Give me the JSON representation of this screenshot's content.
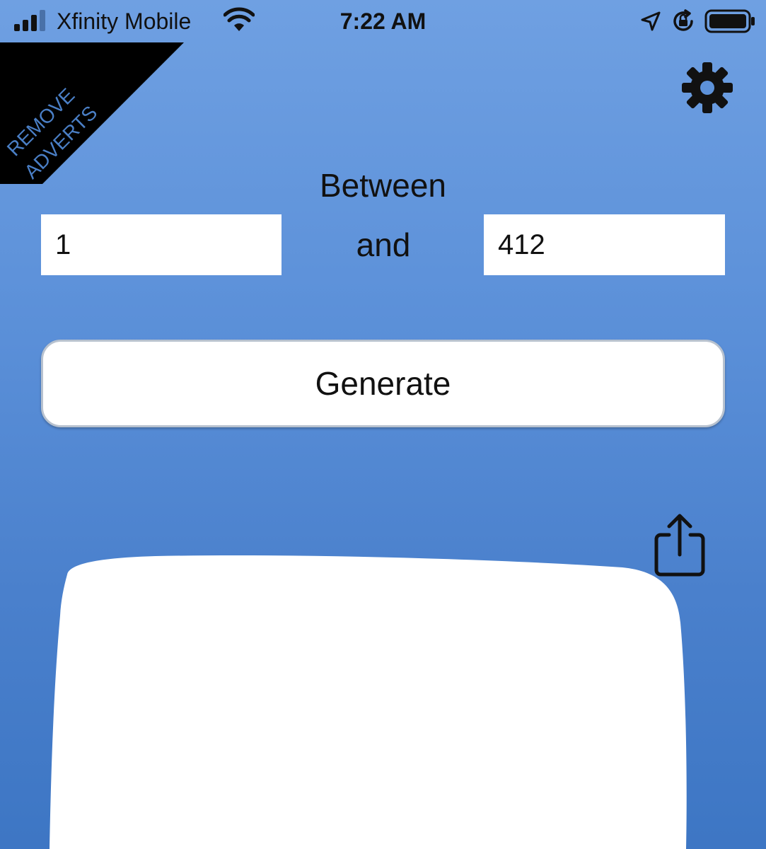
{
  "status_bar": {
    "carrier": "Xfinity Mobile",
    "time": "7:22 AM",
    "icons": [
      "signal-bars-icon",
      "wifi-icon",
      "location-arrow-icon",
      "orientation-lock-icon",
      "battery-icon"
    ]
  },
  "corner_banner": {
    "line1": "REMOVE",
    "line2": "ADVERTS"
  },
  "form": {
    "between_label": "Between",
    "and_label": "and",
    "min_value": "1",
    "max_value": "412"
  },
  "actions": {
    "generate_label": "Generate",
    "settings_icon": "gear-icon",
    "share_icon": "share-icon"
  },
  "colors": {
    "background_top": "#6fa0e2",
    "background_bottom": "#3d76c4",
    "banner": "#000000",
    "banner_text": "#4a7fc6",
    "input_bg": "#ffffff"
  }
}
